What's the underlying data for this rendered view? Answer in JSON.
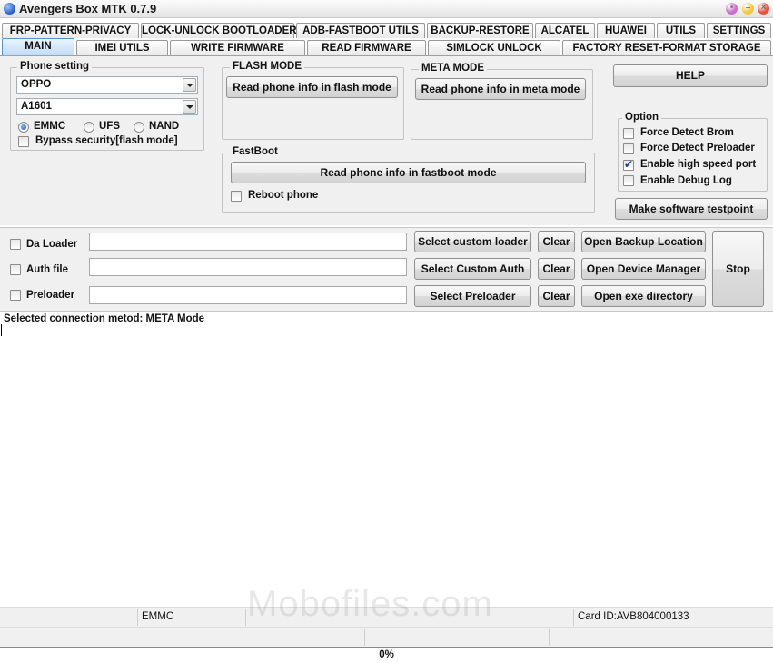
{
  "window": {
    "title": "Avengers Box MTK 0.7.9",
    "buttons": [
      {
        "name": "pin",
        "color": "#c86fd0"
      },
      {
        "name": "minimize",
        "color": "#f2c744"
      },
      {
        "name": "maximize",
        "color": "#f39a33"
      },
      {
        "name": "close",
        "color": "#e5533d"
      }
    ]
  },
  "tabs_row1": [
    "FRP-PATTERN-PRIVACY",
    "LOCK-UNLOCK BOOTLOADER",
    "ADB-FASTBOOT UTILS",
    "BACKUP-RESTORE",
    "ALCATEL",
    "HUAWEI",
    "UTILS",
    "SETTINGS"
  ],
  "tabs_row2": [
    "MAIN",
    "IMEI UTILS",
    "WRITE FIRMWARE",
    "READ FIRMWARE",
    "SIMLOCK UNLOCK",
    "FACTORY RESET-FORMAT STORAGE"
  ],
  "active_tab": "MAIN",
  "phone_setting": {
    "label": "Phone setting",
    "brand": "OPPO",
    "model": "A1601",
    "storage_options": [
      "EMMC",
      "UFS",
      "NAND"
    ],
    "storage_selected": "EMMC",
    "bypass_label": "Bypass security[flash mode]",
    "bypass_checked": false
  },
  "flash_mode": {
    "label": "FLASH MODE",
    "button": "Read phone info in flash mode"
  },
  "meta_mode": {
    "label": "META MODE",
    "button": "Read phone info in meta mode"
  },
  "fastboot": {
    "label": "FastBoot",
    "button": "Read phone info in fastboot mode",
    "reboot_label": "Reboot phone",
    "reboot_checked": false
  },
  "help_button": "HELP",
  "option": {
    "label": "Option",
    "items": [
      {
        "label": "Force Detect Brom",
        "checked": false
      },
      {
        "label": "Force Detect Preloader",
        "checked": false
      },
      {
        "label": "Enable high speed port",
        "checked": true
      },
      {
        "label": "Enable Debug Log",
        "checked": false
      }
    ]
  },
  "testpoint_button": "Make software testpoint",
  "loaders": [
    {
      "label": "Da Loader",
      "value": "",
      "select": "Select custom loader",
      "clear": "Clear",
      "action": "Open Backup Location"
    },
    {
      "label": "Auth file",
      "value": "",
      "select": "Select Custom Auth",
      "clear": "Clear",
      "action": "Open Device Manager"
    },
    {
      "label": "Preloader",
      "value": "",
      "select": "Select Preloader",
      "clear": "Clear",
      "action": "Open exe directory"
    }
  ],
  "stop_button": "Stop",
  "log": {
    "line1": "Selected connection metod: META Mode"
  },
  "status": {
    "storage": "EMMC",
    "card_id": "Card ID:AVB804000133"
  },
  "progress": {
    "text": "0%",
    "value": 0
  },
  "watermark": "Mobofiles.com"
}
